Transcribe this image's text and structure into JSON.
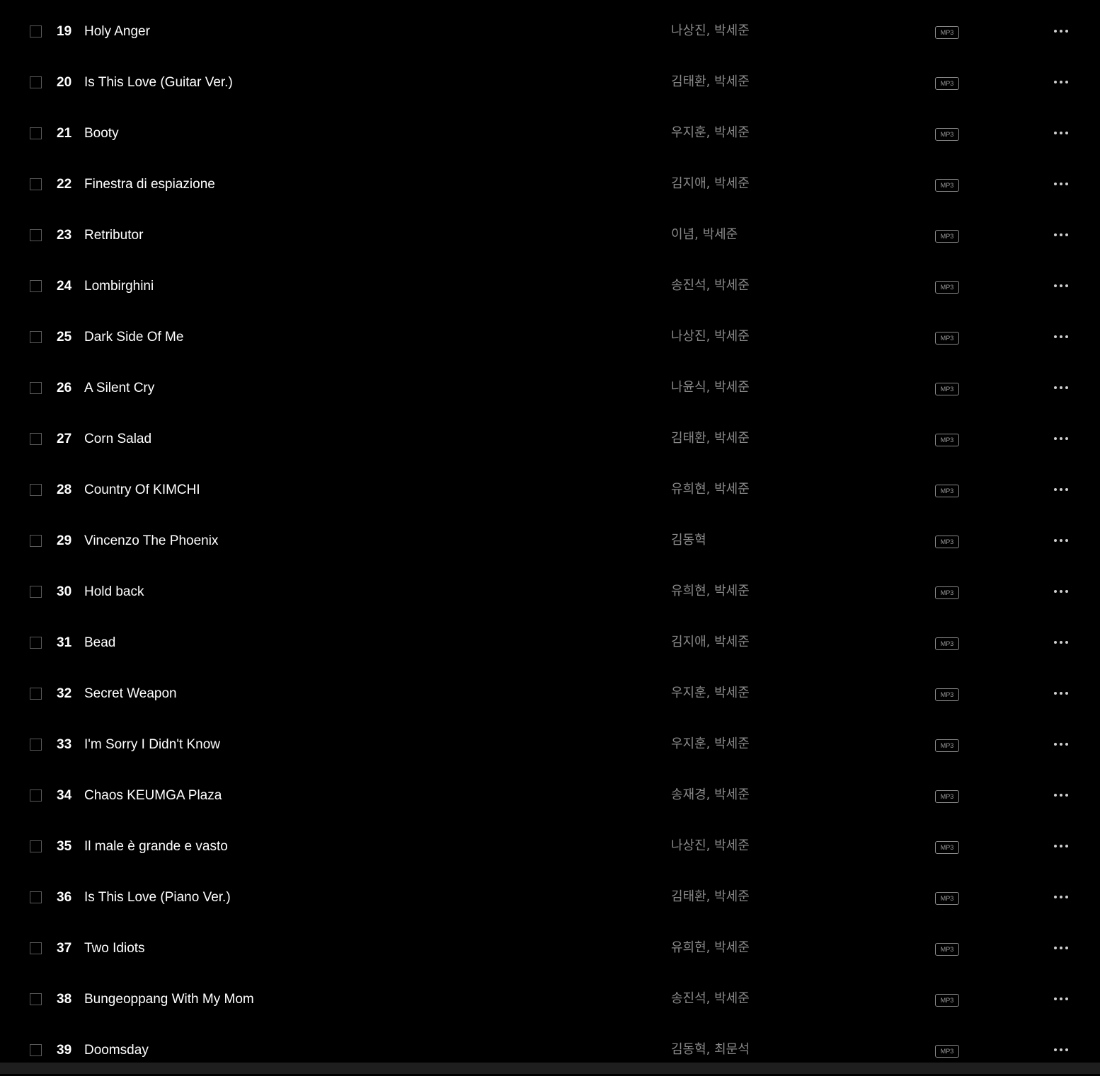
{
  "track_list": {
    "tracks": [
      {
        "number": "19",
        "title": "Holy Anger",
        "artist": "나상진, 박세준",
        "format": "MP3"
      },
      {
        "number": "20",
        "title": "Is This Love (Guitar Ver.)",
        "artist": "김태환, 박세준",
        "format": "MP3"
      },
      {
        "number": "21",
        "title": "Booty",
        "artist": "우지훈, 박세준",
        "format": "MP3"
      },
      {
        "number": "22",
        "title": "Finestra di espiazione",
        "artist": "김지애, 박세준",
        "format": "MP3"
      },
      {
        "number": "23",
        "title": "Retributor",
        "artist": "이념, 박세준",
        "format": "MP3"
      },
      {
        "number": "24",
        "title": "Lombirghini",
        "artist": "송진석, 박세준",
        "format": "MP3"
      },
      {
        "number": "25",
        "title": "Dark Side Of Me",
        "artist": "나상진, 박세준",
        "format": "MP3"
      },
      {
        "number": "26",
        "title": "A Silent Cry",
        "artist": "나윤식, 박세준",
        "format": "MP3"
      },
      {
        "number": "27",
        "title": "Corn Salad",
        "artist": "김태환, 박세준",
        "format": "MP3"
      },
      {
        "number": "28",
        "title": "Country Of KIMCHI",
        "artist": "유희현, 박세준",
        "format": "MP3"
      },
      {
        "number": "29",
        "title": "Vincenzo The Phoenix",
        "artist": "김동혁",
        "format": "MP3"
      },
      {
        "number": "30",
        "title": "Hold back",
        "artist": "유희현, 박세준",
        "format": "MP3"
      },
      {
        "number": "31",
        "title": "Bead",
        "artist": "김지애, 박세준",
        "format": "MP3"
      },
      {
        "number": "32",
        "title": "Secret Weapon",
        "artist": "우지훈, 박세준",
        "format": "MP3"
      },
      {
        "number": "33",
        "title": "I'm Sorry I Didn't Know",
        "artist": "우지훈, 박세준",
        "format": "MP3"
      },
      {
        "number": "34",
        "title": "Chaos KEUMGA Plaza",
        "artist": "송재경, 박세준",
        "format": "MP3"
      },
      {
        "number": "35",
        "title": "Il male è grande e vasto",
        "artist": "나상진, 박세준",
        "format": "MP3"
      },
      {
        "number": "36",
        "title": "Is This Love (Piano Ver.)",
        "artist": "김태환, 박세준",
        "format": "MP3"
      },
      {
        "number": "37",
        "title": "Two Idiots",
        "artist": "유희현, 박세준",
        "format": "MP3"
      },
      {
        "number": "38",
        "title": "Bungeoppang With My Mom",
        "artist": "송진석, 박세준",
        "format": "MP3"
      },
      {
        "number": "39",
        "title": "Doomsday",
        "artist": "김동혁, 최문석",
        "format": "MP3"
      }
    ]
  },
  "icons": {
    "row_checkbox": "checkbox-icon",
    "row_more": "more-options-icon"
  },
  "colors": {
    "background": "#000000",
    "title_text": "#ffffff",
    "artist_text": "#8a8a8a",
    "checkbox_border": "#5a5a5a",
    "bottom_bar": "#1e1e1e"
  }
}
